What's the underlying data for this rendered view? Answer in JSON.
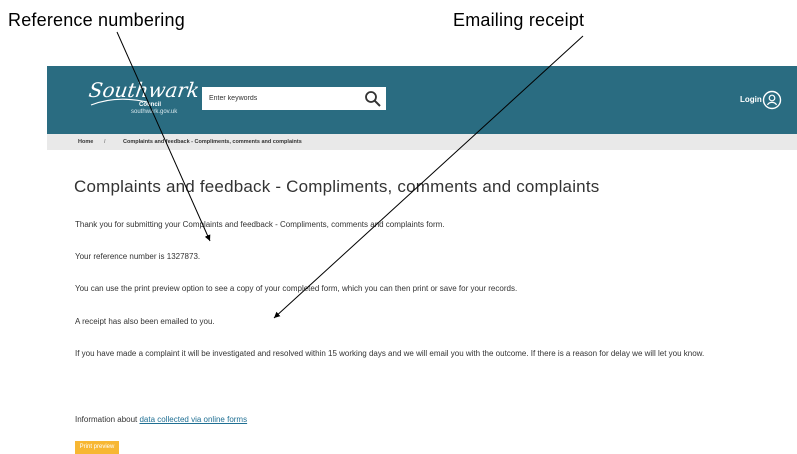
{
  "annotations": {
    "reference": "Reference numbering",
    "emailing": "Emailing receipt"
  },
  "header": {
    "logo_script": "Southwark",
    "logo_council": "Council",
    "logo_url": "southwark.gov.uk",
    "search_placeholder": "Enter keywords",
    "login_label": "Login"
  },
  "breadcrumb": {
    "home": "Home",
    "separator": "/",
    "current": "Complaints and feedback - Compliments, comments and complaints"
  },
  "main": {
    "title": "Complaints and feedback - Compliments, comments and complaints",
    "thanks": "Thank you for submitting your Complaints and feedback - Compliments, comments and complaints form.",
    "reference": "Your reference number is 1327873.",
    "print_info": "You can use the print preview option to see a copy of your completed form, which you can then print or save for your records.",
    "receipt": "A receipt has also been emailed to you.",
    "complaint_info": "If you have made a complaint it will be investigated and resolved within 15 working days and we will email you with the outcome. If there is a reason for delay we will let you know.",
    "info_prefix": "Information about ",
    "info_link": "data collected via online forms",
    "print_button": "Print preview"
  },
  "colors": {
    "header": "#2a6c81",
    "breadcrumb_bg": "#e9e9e9",
    "button": "#f7b733",
    "link": "#1f6f93"
  }
}
